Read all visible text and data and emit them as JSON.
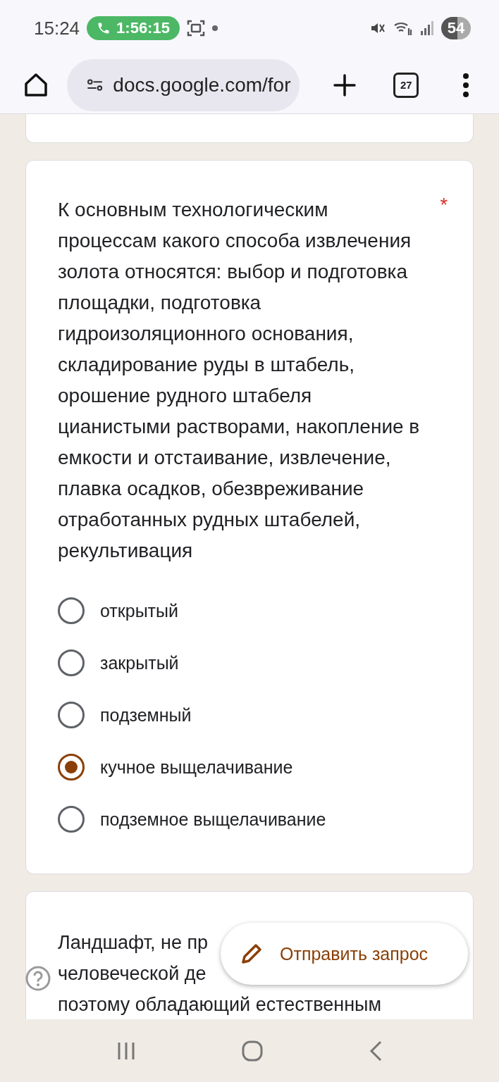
{
  "status_bar": {
    "time": "15:24",
    "call_timer": "1:56:15",
    "battery": "54"
  },
  "browser": {
    "url": "docs.google.com/for",
    "tab_count": "27"
  },
  "question": {
    "text": "К основным технологическим процессам какого способа извлечения золота относятся: выбор и подготовка площадки, подготовка гидроизоляционного основания, складирование руды в штабель, орошение рудного штабеля цианистыми растворами, накопление в емкости и отстаивание, извлечение, плавка осадков, обезвреживание отработанных рудных штабелей, рекультивация",
    "required_mark": "*",
    "options": [
      {
        "label": "открытый",
        "selected": false
      },
      {
        "label": "закрытый",
        "selected": false
      },
      {
        "label": "подземный",
        "selected": false
      },
      {
        "label": "кучное выщелачивание",
        "selected": true
      },
      {
        "label": "подземное выщелачивание",
        "selected": false
      }
    ]
  },
  "next_question": {
    "lines": [
      "Ландшафт, не пр",
      "человеческой де",
      "поэтому обладающий естественным"
    ]
  },
  "fab": {
    "label": "Отправить запрос"
  }
}
